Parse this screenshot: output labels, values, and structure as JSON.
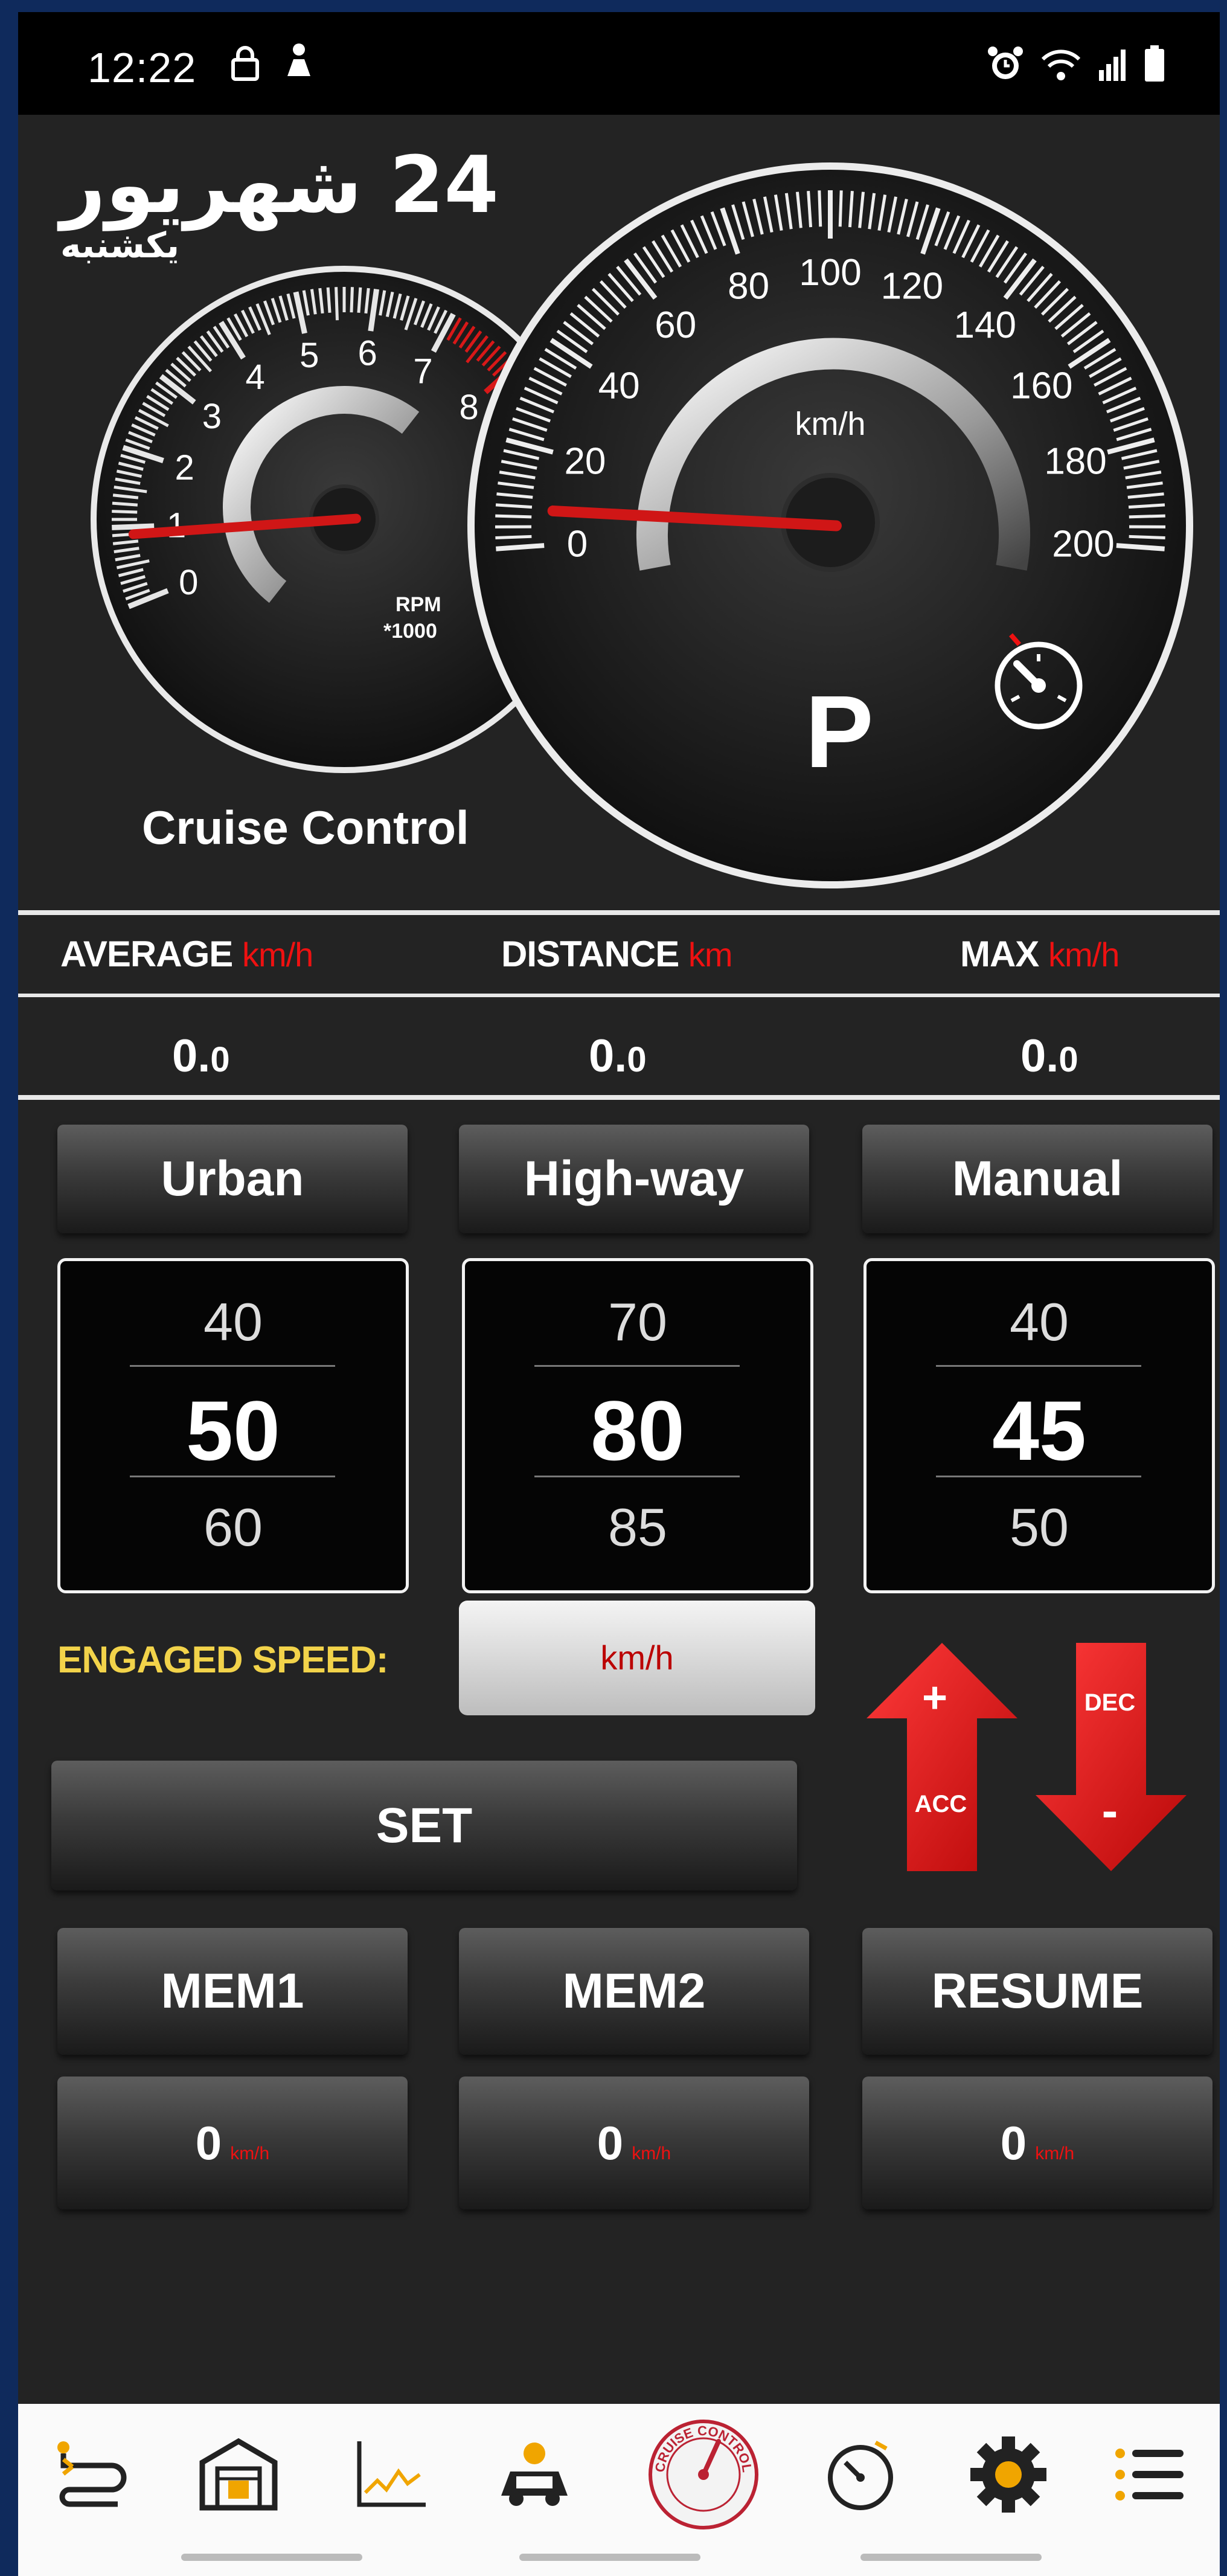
{
  "status_bar": {
    "time": "12:22",
    "icons_left": [
      "lock-icon",
      "person-icon"
    ],
    "icons_right": [
      "alarm-icon",
      "wifi-icon",
      "signal-icon",
      "battery-icon"
    ]
  },
  "header": {
    "date_day": "24 شهریور",
    "weekday": "یکشنبه"
  },
  "rpm_gauge": {
    "ticks": [
      "0",
      "1",
      "2",
      "3",
      "4",
      "5",
      "6",
      "7",
      "8"
    ],
    "unit_line1": "RPM",
    "unit_line2": "*1000",
    "value": 0.9
  },
  "speed_gauge": {
    "ticks": [
      "0",
      "20",
      "40",
      "60",
      "80",
      "100",
      "120",
      "140",
      "160",
      "180",
      "200"
    ],
    "unit": "km/h",
    "gear": "P",
    "value": 0
  },
  "cruise_title": "Cruise Control",
  "stats": {
    "average": {
      "label": "AVERAGE",
      "unit": "km/h",
      "value": "0.",
      "decimal": "0"
    },
    "distance": {
      "label": "DISTANCE",
      "unit": "km",
      "value": "0.",
      "decimal": "0"
    },
    "max": {
      "label": "MAX",
      "unit": "km/h",
      "value": "0.",
      "decimal": "0"
    }
  },
  "modes": [
    {
      "label": "Urban",
      "top": "40",
      "mid": "50",
      "bot": "60"
    },
    {
      "label": "High-way",
      "top": "70",
      "mid": "80",
      "bot": "85"
    },
    {
      "label": "Manual",
      "top": "40",
      "mid": "45",
      "bot": "50"
    }
  ],
  "engaged": {
    "label": "ENGAGED SPEED:",
    "unit": "km/h"
  },
  "set_label": "SET",
  "acc": {
    "sign": "+",
    "label": "ACC"
  },
  "dec": {
    "sign": "-",
    "label": "DEC"
  },
  "memory": [
    {
      "label": "MEM1",
      "value": "0",
      "unit": "km/h"
    },
    {
      "label": "MEM2",
      "value": "0",
      "unit": "km/h"
    },
    {
      "label": "RESUME",
      "value": "0",
      "unit": "km/h"
    }
  ],
  "bottom_nav": {
    "icons": [
      "route-icon",
      "garage-icon",
      "chart-icon",
      "car-service-icon",
      "cruise-control-icon",
      "speedometer-icon",
      "settings-icon",
      "menu-icon"
    ],
    "badge_text": "CRUISE CONTROL"
  },
  "colors": {
    "accent_red": "#e01818",
    "engaged_yellow": "#f2d34a",
    "background": "#232323"
  }
}
